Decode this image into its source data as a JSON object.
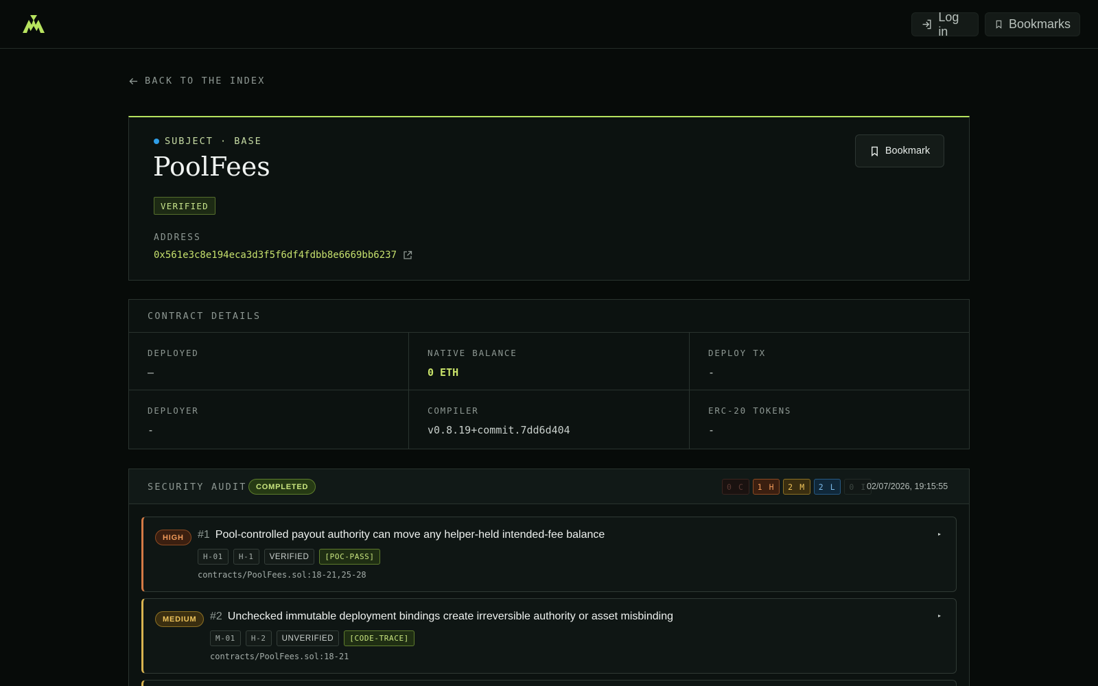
{
  "topbar": {
    "logo_icon": "mountain-logo-icon",
    "login_label": "Log in",
    "bookmarks_label": "Bookmarks"
  },
  "back_link": "BACK TO THE INDEX",
  "subject": {
    "kind_label": "SUBJECT · BASE",
    "name": "PoolFees",
    "verified_label": "VERIFIED",
    "address_label": "ADDRESS",
    "address": "0x561e3c8e194eca3d3f5f6df4fdbb8e6669bb6237",
    "bookmark_label": "Bookmark"
  },
  "details": {
    "header": "CONTRACT DETAILS",
    "cells": [
      {
        "label": "DEPLOYED",
        "value": "—"
      },
      {
        "label": "NATIVE BALANCE",
        "value": "0 ETH"
      },
      {
        "label": "DEPLOY TX",
        "value": "-"
      },
      {
        "label": "DEPLOYER",
        "value": "-"
      },
      {
        "label": "COMPILER",
        "value": "v0.8.19+commit.7dd6d404"
      },
      {
        "label": "ERC-20 TOKENS",
        "value": "-"
      }
    ]
  },
  "audit": {
    "title": "SECURITY AUDIT",
    "status": "COMPLETED",
    "counts": {
      "c": "0 C",
      "h": "1 H",
      "m": "2 M",
      "l": "2 L",
      "i": "0 I"
    },
    "date": "02/07/2026, 19:15:55",
    "findings": [
      {
        "severity": "HIGH",
        "number": "#1",
        "title": "Pool-controlled payout authority can move any helper-held intended-fee balance",
        "tags": [
          "H-01",
          "H-1",
          "VERIFIED",
          "[POC-PASS]"
        ],
        "path": "contracts/PoolFees.sol:18-21,25-28"
      },
      {
        "severity": "MEDIUM",
        "number": "#2",
        "title": "Unchecked immutable deployment bindings create irreversible authority or asset misbinding",
        "tags": [
          "M-01",
          "H-2",
          "UNVERIFIED",
          "[CODE-TRACE]"
        ],
        "path": "contracts/PoolFees.sol:18-21"
      }
    ]
  },
  "colors": {
    "accent": "#b7e35f",
    "high": "#f19a5a",
    "medium": "#efc45b",
    "low": "#7dbbea"
  }
}
